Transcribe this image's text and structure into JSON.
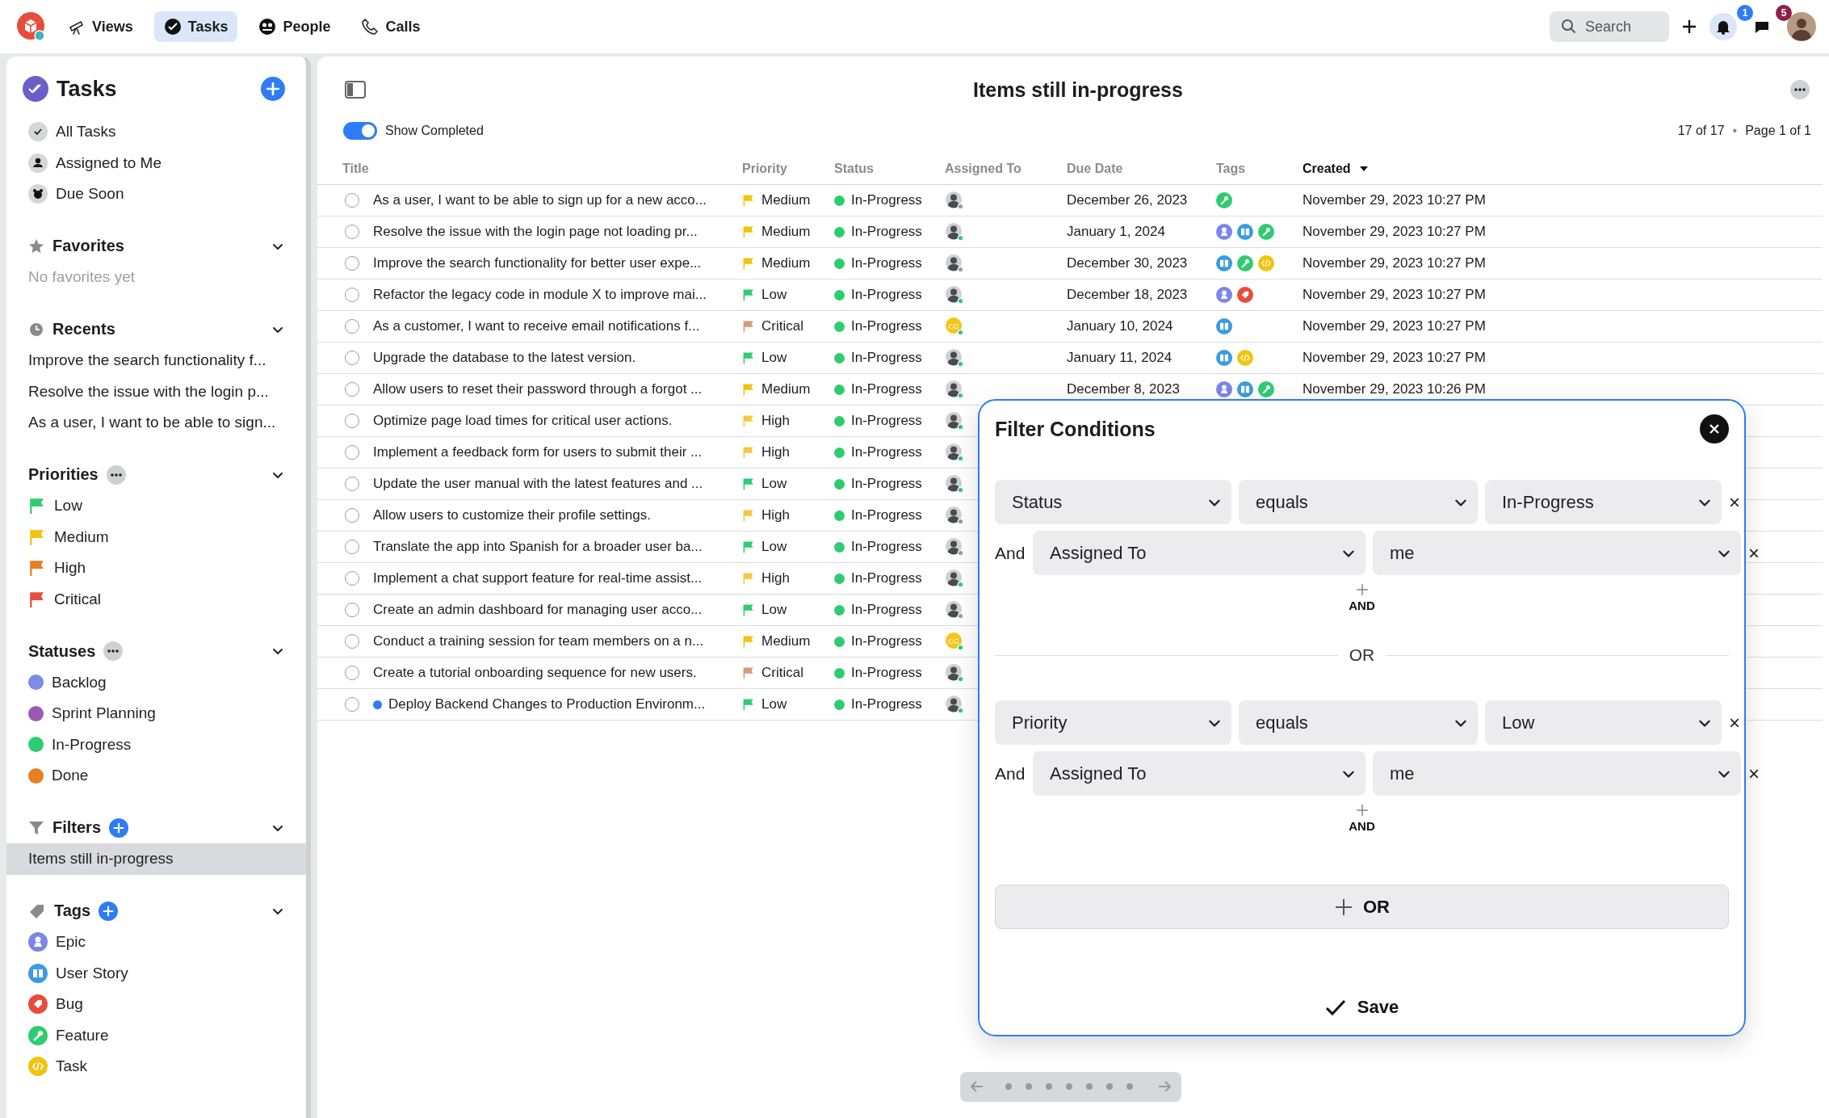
{
  "nav": {
    "tabs": [
      {
        "label": "Views",
        "selected": false
      },
      {
        "label": "Tasks",
        "selected": true
      },
      {
        "label": "People",
        "selected": false
      },
      {
        "label": "Calls",
        "selected": false
      }
    ],
    "search": "Search",
    "notifications": "1",
    "messages": "5"
  },
  "sidebar": {
    "title": "Tasks",
    "views": [
      {
        "label": "All Tasks"
      },
      {
        "label": "Assigned to Me"
      },
      {
        "label": "Due Soon"
      }
    ],
    "favorites": {
      "title": "Favorites",
      "empty": "No favorites yet"
    },
    "recents": {
      "title": "Recents",
      "items": [
        "Improve the search functionality f...",
        "Resolve the issue with the login p...",
        "As a user, I want to be able to sign..."
      ]
    },
    "priorities": {
      "title": "Priorities",
      "items": [
        {
          "label": "Low",
          "color": "#2ecc71"
        },
        {
          "label": "Medium",
          "color": "#f1c40f"
        },
        {
          "label": "High",
          "color": "#e67e22"
        },
        {
          "label": "Critical",
          "color": "#e74c3c"
        }
      ]
    },
    "statuses": {
      "title": "Statuses",
      "items": [
        {
          "label": "Backlog",
          "color": "#7b8cea"
        },
        {
          "label": "Sprint Planning",
          "color": "#9b59b6"
        },
        {
          "label": "In-Progress",
          "color": "#2ecc71"
        },
        {
          "label": "Done",
          "color": "#e67e22"
        }
      ]
    },
    "filters": {
      "title": "Filters",
      "items": [
        {
          "label": "Items still in-progress",
          "selected": true
        }
      ]
    },
    "tags": {
      "title": "Tags",
      "items": [
        {
          "label": "Epic",
          "kind": "epic",
          "color": "#7b86e8"
        },
        {
          "label": "User Story",
          "kind": "story",
          "color": "#3b9ae1"
        },
        {
          "label": "Bug",
          "kind": "bug",
          "color": "#e74c3c"
        },
        {
          "label": "Feature",
          "kind": "feature",
          "color": "#2ecc71"
        },
        {
          "label": "Task",
          "kind": "task",
          "color": "#f1c40f"
        }
      ]
    }
  },
  "main": {
    "title": "Items still in-progress",
    "show_completed": {
      "label": "Show Completed",
      "on": true
    },
    "count": "17 of 17",
    "separator": "•",
    "page": "Page 1 of 1",
    "columns": [
      {
        "label": "Title",
        "sorted": false
      },
      {
        "label": "Priority",
        "sorted": false
      },
      {
        "label": "Status",
        "sorted": false
      },
      {
        "label": "Assigned To",
        "sorted": false
      },
      {
        "label": "Due Date",
        "sorted": false
      },
      {
        "label": "Tags",
        "sorted": false
      },
      {
        "label": "Created",
        "sorted": true
      }
    ],
    "rows": [
      {
        "completed": false,
        "title": "As a user, I want to be able to sign up for a new acco...",
        "marked": false,
        "priority": {
          "label": "Medium",
          "color": "#f1c40f"
        },
        "status": "In-Progress",
        "assignee": {
          "kind": "photo",
          "online": false
        },
        "due": "December 26, 2023",
        "tags": [
          {
            "kind": "feature"
          }
        ],
        "created": "November 29, 2023 10:27 PM"
      },
      {
        "completed": false,
        "title": "Resolve the issue with the login page not loading pr...",
        "marked": false,
        "priority": {
          "label": "Medium",
          "color": "#f1c40f"
        },
        "status": "In-Progress",
        "assignee": {
          "kind": "photo",
          "online": true
        },
        "due": "January 1, 2024",
        "tags": [
          {
            "kind": "epic"
          },
          {
            "kind": "story"
          },
          {
            "kind": "feature"
          }
        ],
        "created": "November 29, 2023 10:27 PM"
      },
      {
        "completed": false,
        "title": "Improve the search functionality for better user expe...",
        "marked": false,
        "priority": {
          "label": "Medium",
          "color": "#f1c40f"
        },
        "status": "In-Progress",
        "assignee": {
          "kind": "photo",
          "online": false
        },
        "due": "December 30, 2023",
        "tags": [
          {
            "kind": "story"
          },
          {
            "kind": "feature"
          },
          {
            "kind": "task"
          }
        ],
        "created": "November 29, 2023 10:27 PM"
      },
      {
        "completed": false,
        "title": "Refactor the legacy code in module X to improve mai...",
        "marked": false,
        "priority": {
          "label": "Low",
          "color": "#2ecc71"
        },
        "status": "In-Progress",
        "assignee": {
          "kind": "photo",
          "online": true
        },
        "due": "December 18, 2023",
        "tags": [
          {
            "kind": "epic"
          },
          {
            "kind": "bug"
          }
        ],
        "created": "November 29, 2023 10:27 PM"
      },
      {
        "completed": false,
        "title": "As a customer, I want to receive email notifications f...",
        "marked": false,
        "priority": {
          "label": "Critical",
          "color": "#d99a7a"
        },
        "status": "In-Progress",
        "assignee": {
          "kind": "initials",
          "initials": "CG",
          "online": true
        },
        "due": "January 10, 2024",
        "tags": [
          {
            "kind": "story"
          }
        ],
        "created": "November 29, 2023 10:27 PM"
      },
      {
        "completed": false,
        "title": "Upgrade the database to the latest version.",
        "marked": false,
        "priority": {
          "label": "Low",
          "color": "#2ecc71"
        },
        "status": "In-Progress",
        "assignee": {
          "kind": "photo",
          "online": true
        },
        "due": "January 11, 2024",
        "tags": [
          {
            "kind": "story"
          },
          {
            "kind": "task"
          }
        ],
        "created": "November 29, 2023 10:27 PM"
      },
      {
        "completed": false,
        "title": "Allow users to reset their password through a forgot ...",
        "marked": false,
        "priority": {
          "label": "Medium",
          "color": "#f1c40f"
        },
        "status": "In-Progress",
        "assignee": {
          "kind": "photo",
          "online": true
        },
        "due": "December 8, 2023",
        "tags": [
          {
            "kind": "epic"
          },
          {
            "kind": "story"
          },
          {
            "kind": "feature"
          }
        ],
        "created": "November 29, 2023 10:26 PM"
      },
      {
        "completed": false,
        "title": "Optimize page load times for critical user actions.",
        "marked": false,
        "priority": {
          "label": "High",
          "color": "#f5c842"
        },
        "status": "In-Progress",
        "assignee": {
          "kind": "photo",
          "online": true
        }
      },
      {
        "completed": false,
        "title": "Implement a feedback form for users to submit their ...",
        "marked": false,
        "priority": {
          "label": "High",
          "color": "#f5c842"
        },
        "status": "In-Progress",
        "assignee": {
          "kind": "photo",
          "online": true
        }
      },
      {
        "completed": false,
        "title": "Update the user manual with the latest features and ...",
        "marked": false,
        "priority": {
          "label": "Low",
          "color": "#2ecc71"
        },
        "status": "In-Progress",
        "assignee": {
          "kind": "photo",
          "online": true
        }
      },
      {
        "completed": false,
        "title": "Allow users to customize their profile settings.",
        "marked": false,
        "priority": {
          "label": "High",
          "color": "#f5c842"
        },
        "status": "In-Progress",
        "assignee": {
          "kind": "photo",
          "online": false
        }
      },
      {
        "completed": false,
        "title": "Translate the app into Spanish for a broader user ba...",
        "marked": false,
        "priority": {
          "label": "Low",
          "color": "#2ecc71"
        },
        "status": "In-Progress",
        "assignee": {
          "kind": "photo",
          "online": false
        }
      },
      {
        "completed": false,
        "title": "Implement a chat support feature for real-time assist...",
        "marked": false,
        "priority": {
          "label": "High",
          "color": "#f5c842"
        },
        "status": "In-Progress",
        "assignee": {
          "kind": "photo",
          "online": true
        }
      },
      {
        "completed": false,
        "title": "Create an admin dashboard for managing user acco...",
        "marked": false,
        "priority": {
          "label": "Low",
          "color": "#2ecc71"
        },
        "status": "In-Progress",
        "assignee": {
          "kind": "photo",
          "online": false
        }
      },
      {
        "completed": false,
        "title": "Conduct a training session for team members on a n...",
        "marked": false,
        "priority": {
          "label": "Medium",
          "color": "#f1c40f"
        },
        "status": "In-Progress",
        "assignee": {
          "kind": "initials",
          "initials": "CG",
          "online": true
        }
      },
      {
        "completed": false,
        "title": "Create a tutorial onboarding sequence for new users.",
        "marked": false,
        "priority": {
          "label": "Critical",
          "color": "#d99a7a"
        },
        "status": "In-Progress",
        "assignee": {
          "kind": "photo",
          "online": true
        }
      },
      {
        "completed": false,
        "title": "Deploy Backend Changes to Production Environm...",
        "marked": true,
        "priority": {
          "label": "Low",
          "color": "#2ecc71"
        },
        "status": "In-Progress",
        "assignee": {
          "kind": "photo",
          "online": true
        }
      }
    ]
  },
  "filter_dialog": {
    "title": "Filter Conditions",
    "groups": [
      {
        "conditions": [
          {
            "kind": "where",
            "field": "Status",
            "operator": "equals",
            "value": "In-Progress",
            "remove": "×"
          },
          {
            "kind": "and",
            "joiner": "And",
            "field": "Assigned To",
            "value": "me",
            "remove": "×"
          }
        ],
        "add_label": "AND"
      },
      {
        "conditions": [
          {
            "kind": "where",
            "field": "Priority",
            "operator": "equals",
            "value": "Low",
            "remove": "×"
          },
          {
            "kind": "and",
            "joiner": "And",
            "field": "Assigned To",
            "value": "me",
            "remove": "×"
          }
        ],
        "add_label": "AND"
      }
    ],
    "separator": "OR",
    "add_group": "OR",
    "save": "Save"
  }
}
